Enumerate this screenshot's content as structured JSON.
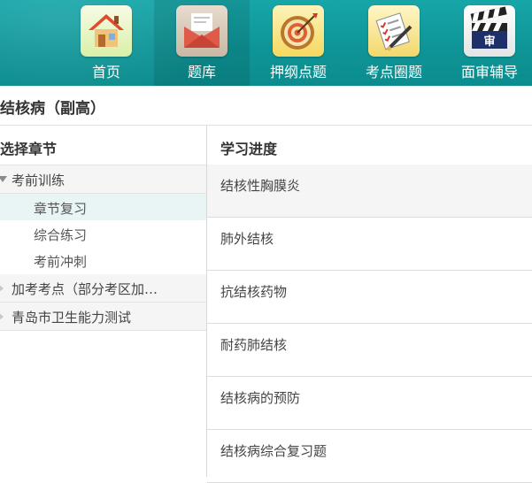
{
  "nav": {
    "items": [
      {
        "label": "首页",
        "icon": "home-icon"
      },
      {
        "label": "题库",
        "icon": "mail-envelope-icon"
      },
      {
        "label": "押纲点题",
        "icon": "target-icon"
      },
      {
        "label": "考点圈题",
        "icon": "checklist-pencil-icon"
      },
      {
        "label": "面审辅导",
        "icon": "clapperboard-icon",
        "badge": "审"
      }
    ],
    "active_index": 1,
    "background_color": "#0f9597"
  },
  "page": {
    "title": "结核病（副高）"
  },
  "left_panel": {
    "header": "选择章节",
    "tree": [
      {
        "label": "考前训练",
        "expanded": true,
        "children": [
          "章节复习",
          "综合练习",
          "考前冲刺"
        ],
        "selected_child": "章节复习"
      },
      {
        "label": "加考考点（部分考区加…",
        "expanded": false
      },
      {
        "label": "青岛市卫生能力测试",
        "expanded": false
      }
    ]
  },
  "right_panel": {
    "header": "学习进度",
    "chapters": [
      "结核性胸膜炎",
      "肺外结核",
      "抗结核药物",
      "耐药肺结核",
      "结核病的预防",
      "结核病综合复习题"
    ]
  }
}
